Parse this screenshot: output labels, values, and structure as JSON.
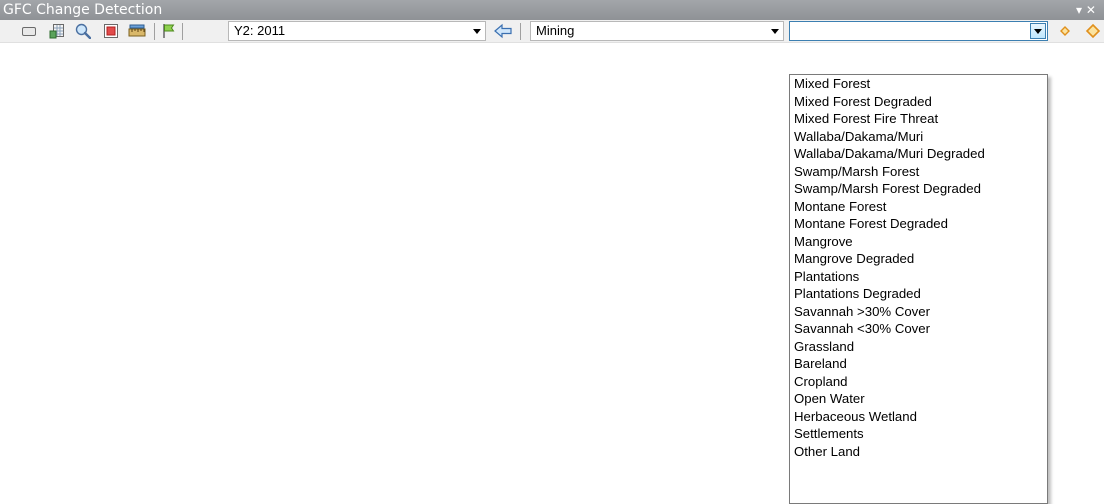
{
  "window": {
    "title": "GFC Change Detection",
    "controls": "▾ ✕"
  },
  "toolbar": {
    "year_combo": {
      "value": "Y2: 2011"
    },
    "class_combo": {
      "value": "Mining"
    },
    "target_combo": {
      "value": ""
    },
    "icons": [
      "identify-window-icon",
      "table-icon",
      "zoom-icon",
      "stop-icon",
      "measure-icon",
      "flag-icon",
      "back-arrow-icon",
      "diamond-icon",
      "diamond-icon"
    ],
    "accent_color": "#3c7fb1",
    "diamond_color": "#f0a830"
  },
  "dropdown": {
    "items": [
      "Mixed Forest",
      "Mixed Forest Degraded",
      "Mixed Forest Fire Threat",
      "Wallaba/Dakama/Muri",
      "Wallaba/Dakama/Muri Degraded",
      "Swamp/Marsh Forest",
      "Swamp/Marsh Forest Degraded",
      "Montane Forest",
      "Montane Forest Degraded",
      "Mangrove",
      "Mangrove Degraded",
      "Plantations",
      "Plantations Degraded",
      "Savannah >30% Cover",
      "Savannah <30% Cover",
      "Grassland",
      "Bareland",
      "Cropland",
      "Open Water",
      "Herbaceous Wetland",
      "Settlements",
      "Other Land"
    ]
  }
}
